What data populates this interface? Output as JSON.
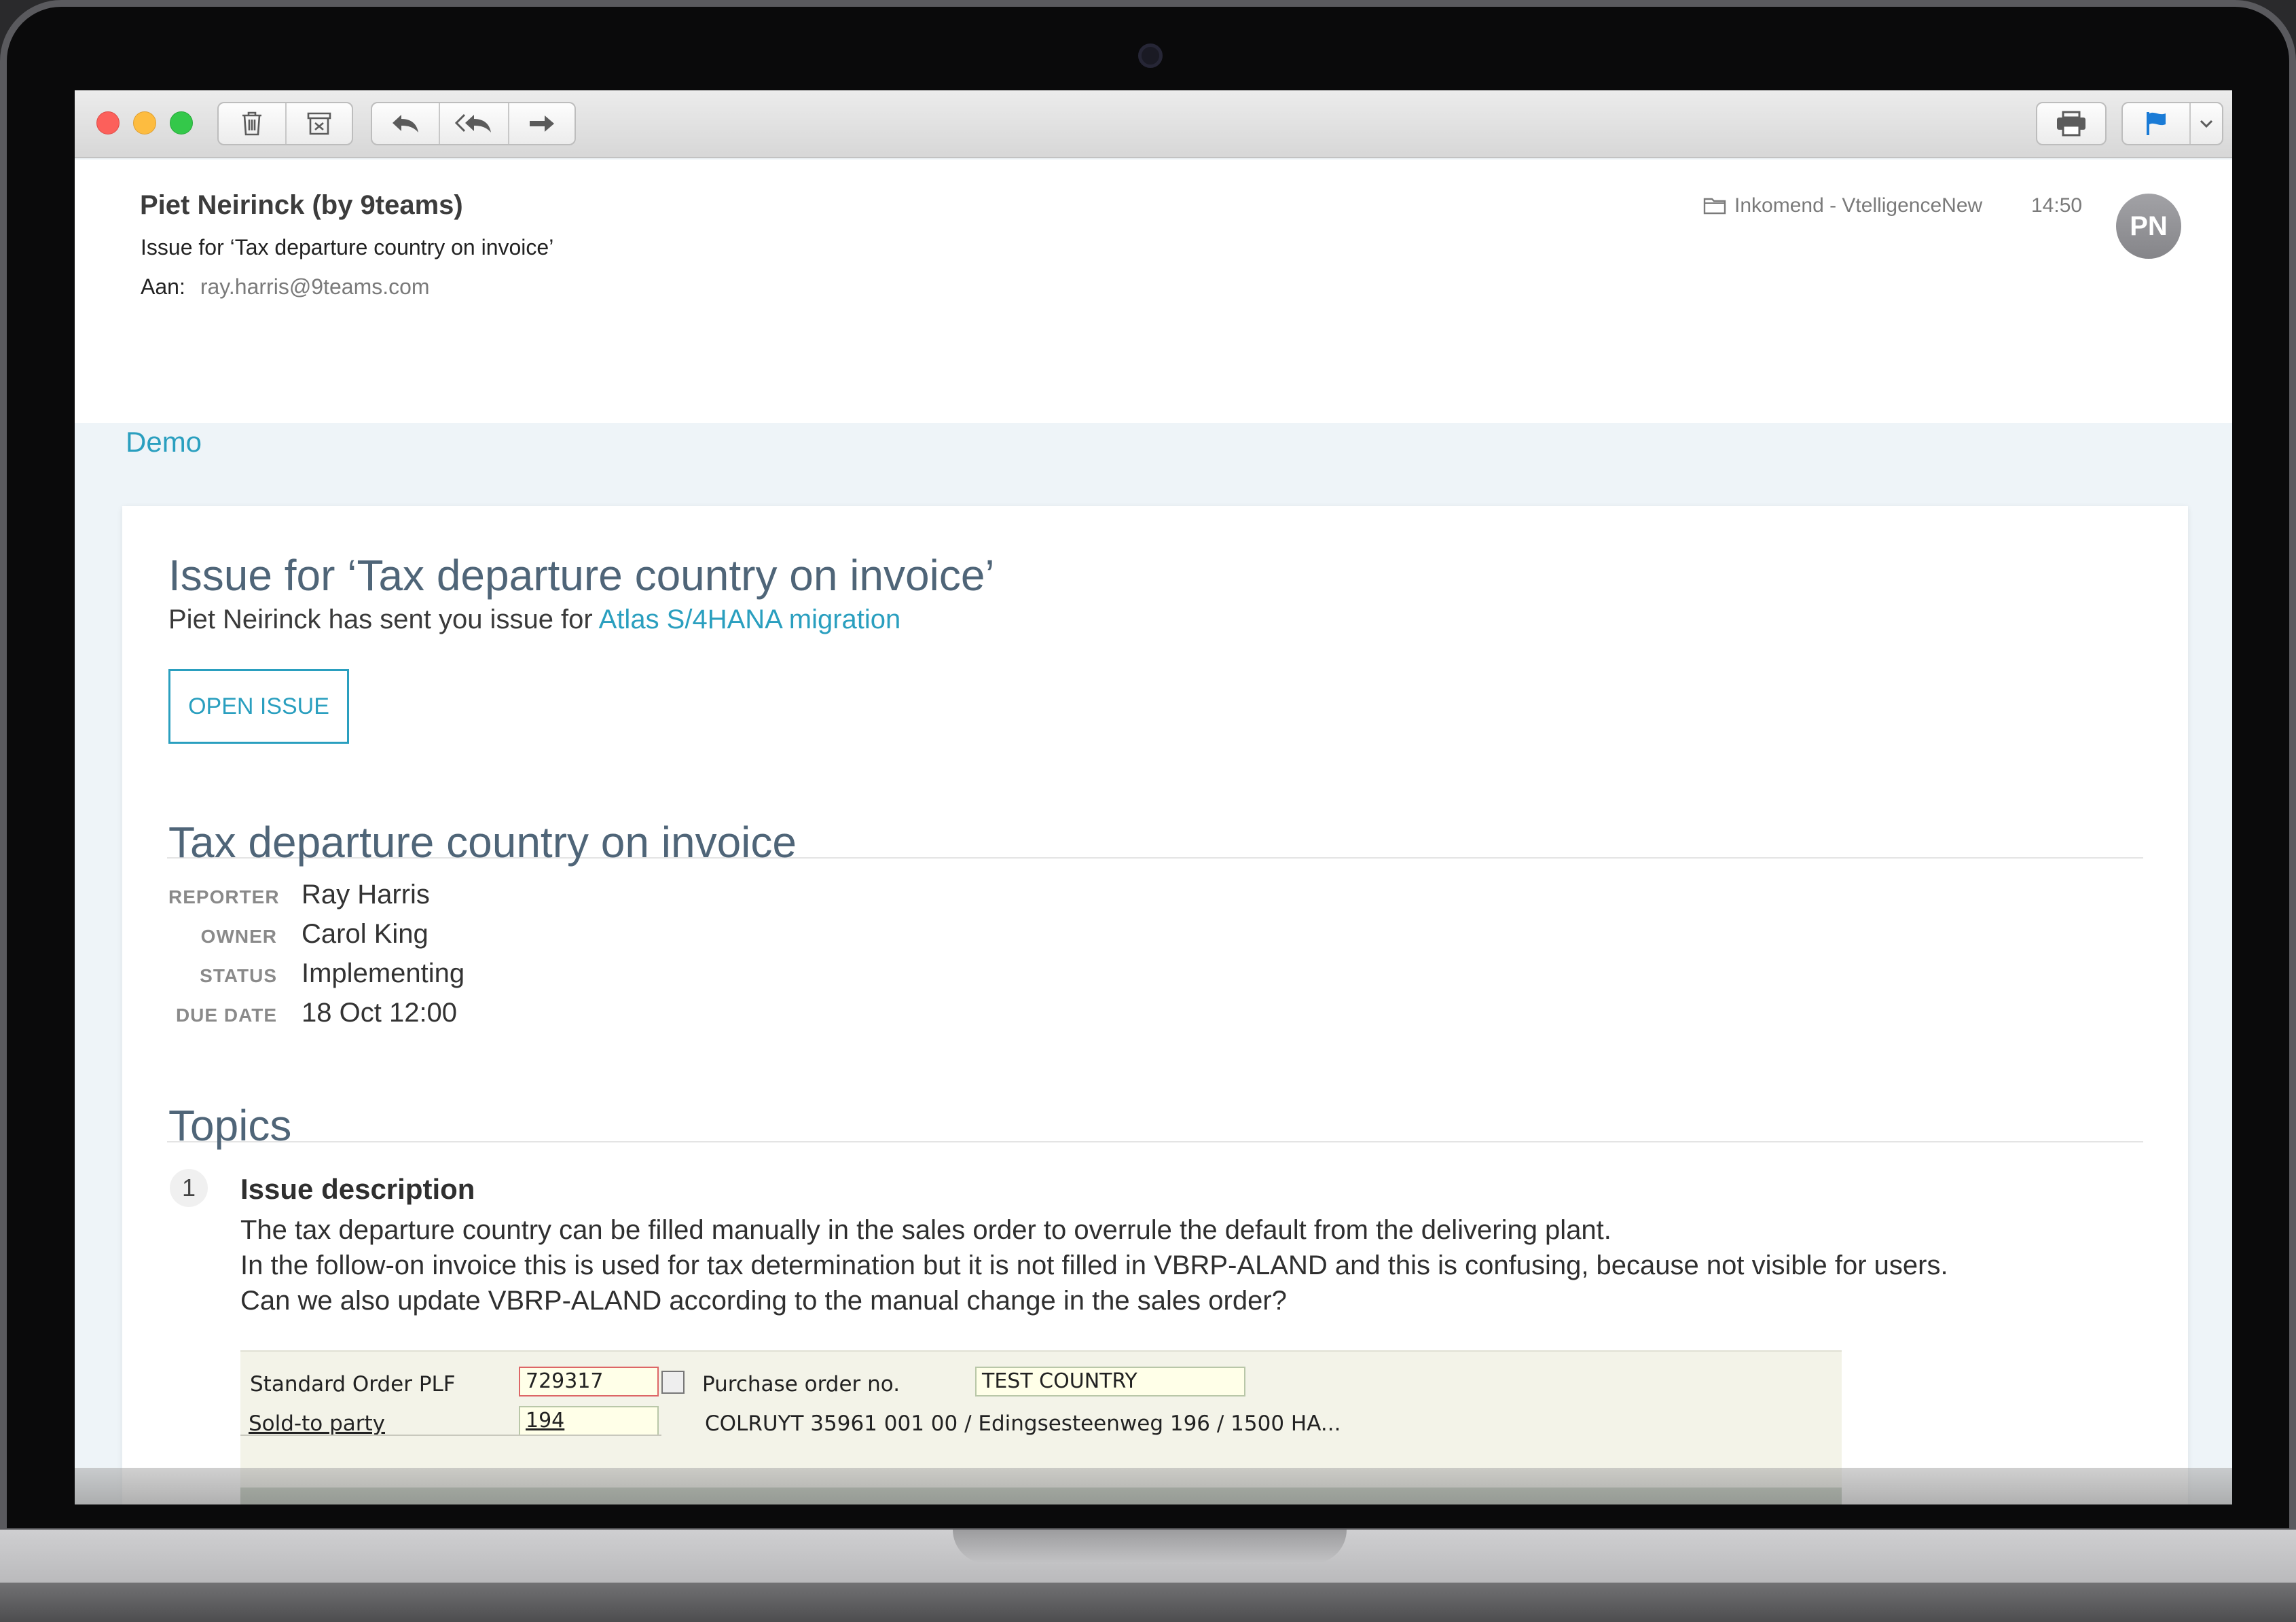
{
  "toolbar": {
    "delete_icon": "trash-icon",
    "archive_icon": "archive-icon",
    "reply_icon": "reply-icon",
    "reply_all_icon": "reply-all-icon",
    "forward_icon": "forward-icon",
    "print_icon": "printer-icon",
    "flag_icon": "flag-icon",
    "flag_color": "#1a7bd6"
  },
  "header": {
    "sender": "Piet Neirinck (by 9teams)",
    "subject": "Issue for ‘Tax departure country on invoice’",
    "to_label": "Aan:",
    "to_value": "ray.harris@9teams.com",
    "folder": "Inkomend - VtelligenceNew",
    "time": "14:50",
    "avatar_initials": "PN"
  },
  "body": {
    "brand_label": "Demo",
    "accent_color": "#2a9fbf",
    "card_title": "Issue for ‘Tax departure country on invoice’",
    "card_sub_prefix": "Piet Neirinck has sent you issue for ",
    "card_sub_link": "Atlas S/4HANA migration",
    "open_button": "OPEN ISSUE",
    "issue_title": "Tax departure country on invoice",
    "meta": [
      {
        "key": "REPORTER",
        "value": "Ray Harris"
      },
      {
        "key": "OWNER",
        "value": "Carol King"
      },
      {
        "key": "STATUS",
        "value": "Implementing"
      },
      {
        "key": "DUE DATE",
        "value": "18 Oct 12:00"
      }
    ],
    "topics_title": "Topics",
    "topics": [
      {
        "number": "1",
        "heading": "Issue description",
        "lines": [
          "The tax departure country can be filled manually in the sales order to overrule the default from the delivering plant.",
          "In the follow-on invoice this is used for tax determination but it is not filled in VBRP-ALAND and this is confusing, because not visible for users.",
          "Can we also update VBRP-ALAND according to the manual change in the sales order?"
        ]
      }
    ],
    "sap": {
      "order_label": "Standard Order PLF",
      "order_value": "729317",
      "po_label": "Purchase order no.",
      "po_value": "TEST COUNTRY",
      "soldto_label": "Sold-to party",
      "soldto_value": "194",
      "soldto_desc": "COLRUYT 35961 001 00 / Edingsesteenweg 196 / 1500 HA..."
    }
  }
}
